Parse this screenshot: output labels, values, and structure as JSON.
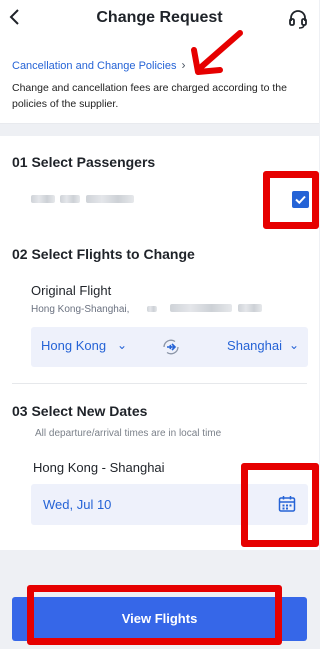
{
  "header": {
    "title": "Change Request",
    "back_icon": "chevron-left-icon",
    "support_icon": "headset-icon"
  },
  "policy": {
    "link_label": "Cancellation and Change Policies",
    "description": "Change and cancellation fees are charged according to the policies of the supplier."
  },
  "passengers": {
    "section_title": "01 Select Passengers",
    "checkbox_checked": true
  },
  "flights": {
    "section_title": "02 Select Flights to Change",
    "original_label": "Original Flight",
    "route_text": "Hong Kong-Shanghai,",
    "from_city": "Hong Kong",
    "to_city": "Shanghai",
    "swap_icon": "plane-swap-icon"
  },
  "dates": {
    "section_title": "03 Select New Dates",
    "note": "All departure/arrival times are in local time",
    "route_label": "Hong Kong - Shanghai",
    "date_value": "Wed, Jul 10",
    "calendar_icon": "calendar-icon"
  },
  "footer": {
    "button_label": "View Flights"
  },
  "colors": {
    "accent": "#2563d6",
    "button": "#3667e8",
    "annotation": "#e60000"
  }
}
